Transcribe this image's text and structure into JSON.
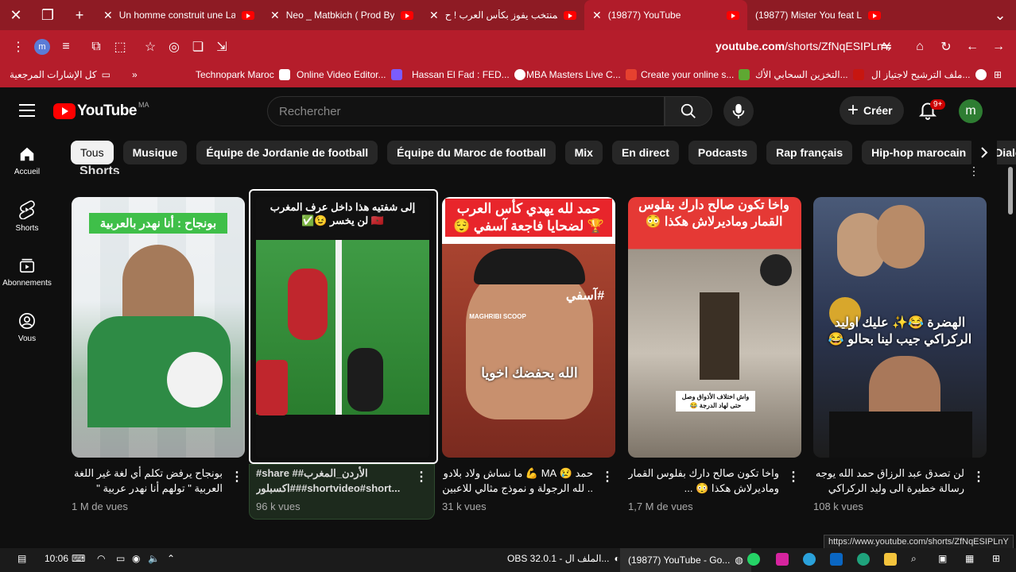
{
  "browser": {
    "tabs": [
      {
        "title": "Un homme construit une La",
        "active": false
      },
      {
        "title": "Neo _ Matbkich ( Prod By N",
        "active": false
      },
      {
        "title": "المنتخب يفوز بكأس العرب ! ح",
        "active": false
      },
      {
        "title": "(19877) YouTube",
        "active": true
      },
      {
        "title": "(19877) Mister You feat L",
        "active": false
      }
    ],
    "url_domain": "youtube.com",
    "url_path": "/shorts/ZfNqESIPLnY",
    "profile_initial": "m",
    "bookmarks": [
      {
        "label": "كل الإشارات المرجعية"
      },
      {
        "label": "Technopark Maroc"
      },
      {
        "label": "Online Video Editor..."
      },
      {
        "label": "Hassan El Fad : FED..."
      },
      {
        "label": "MBA Masters Live C..."
      },
      {
        "label": "Create your online s..."
      },
      {
        "label": "التخزين السحابي الأك..."
      },
      {
        "label": "ملف الترشيح لاجتياز ال..."
      }
    ],
    "bookmarks_overflow": "»"
  },
  "youtube": {
    "logo_text": "YouTube",
    "country": "MA",
    "search_placeholder": "Rechercher",
    "create_label": "Créer",
    "notif_count": "9+",
    "avatar_initial": "m",
    "sidebar": [
      {
        "label": "Accueil",
        "icon": "home-icon"
      },
      {
        "label": "Shorts",
        "icon": "shorts-icon"
      },
      {
        "label": "Abonnements",
        "icon": "subscriptions-icon"
      },
      {
        "label": "Vous",
        "icon": "you-icon"
      }
    ],
    "chips": [
      "Tous",
      "Musique",
      "Équipe de Jordanie de football",
      "Équipe du Maroc de football",
      "Mix",
      "En direct",
      "Podcasts",
      "Rap français",
      "Hip-hop marocain",
      "Dialogues"
    ],
    "section_title": "Shorts",
    "shorts": [
      {
        "overlay": "بونجاح : أنا نهدر بالعربية",
        "title": "بونجاح يرفض تكلم أي لغة غير اللغة العربية \" تولهم أنا نهدر عربية \"",
        "views": "1 M de vues",
        "thumb_color": "#2f6f3a"
      },
      {
        "overlay": "إلى شفتيه هذا داخل عرف المغرب 🇲🇦 لن يخسر 😉✅",
        "title": "#share #الأردن_المغرب# #اكسبلور##shortvideo#short...",
        "views": "96 k vues",
        "thumb_color": "#2a7d2e"
      },
      {
        "overlay": "حمد لله يهدي كأس العرب 🏆 لضحايا فاجعة آسفي 😌",
        "overlay2": "الله يحفضك اخويا",
        "overlay3": "#آسفي",
        "watermark": "MAGHRIBI SCOOP",
        "title": "حمد 😢 MA 💪 ما نساش ولاد بلادو .. لله الرجولة و نموذج مثالي للاعبين",
        "views": "31 k vues",
        "thumb_color": "#8a3b2b"
      },
      {
        "overlay": "واخا تكون صالح دارك بفلوس القمار وماديرلاش هكذا 😳",
        "overlay2": "واش اختلاف الأذواق وصل حتى لهاد الدرجة 😂",
        "title": "واخا تكون صالح دارك بفلوس القمار وماديرلاش هكذا 😳 ...",
        "views": "1,7 M de vues",
        "thumb_color": "#8a8075"
      },
      {
        "overlay": "الهضرة 😂✨ عليك اوليد الركراكي جيب لينا بحالو 😂",
        "title": "لن تصدق عبد الرزاق حمد الله يوجه رسالة خطيرة الى وليد الركراكي حتا ...",
        "views": "108 k vues",
        "thumb_color": "#2b3550"
      }
    ]
  },
  "status_url": "https://www.youtube.com/shorts/ZfNqESIPLnY",
  "taskbar": {
    "time": "10:06",
    "obs_label": "OBS 32.0.1 - الملف ال...",
    "yt_window": "(19877) YouTube - Go..."
  },
  "colors": {
    "chrome_red": "#b51d2b",
    "tab_dark_red": "#8e1b24",
    "youtube_red": "#ff0000",
    "background": "#0f0f0f"
  }
}
